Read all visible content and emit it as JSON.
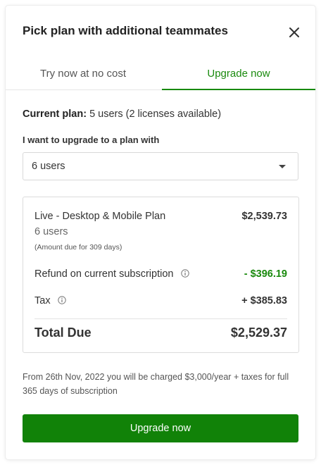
{
  "dialog": {
    "title": "Pick plan with additional teammates",
    "close_icon": "close-icon"
  },
  "tabs": [
    {
      "label": "Try now at no cost",
      "active": false
    },
    {
      "label": "Upgrade now",
      "active": true
    }
  ],
  "current_plan": {
    "label": "Current plan:",
    "value": "5 users (2 licenses available)"
  },
  "upgrade_select": {
    "label": "I want to upgrade to a plan with",
    "selected": "6 users",
    "icon": "chevron-down-icon"
  },
  "summary": {
    "plan_name": "Live - Desktop & Mobile Plan",
    "plan_price": "$2,539.73",
    "plan_users": "6 users",
    "plan_note": "(Amount due for 309 days)",
    "refund_label": "Refund on current subscription",
    "refund_value": "- $396.19",
    "tax_label": "Tax",
    "tax_value": "+ $385.83",
    "total_label": "Total Due",
    "total_value": "$2,529.37"
  },
  "footnote": "From 26th Nov, 2022 you will be charged $3,000/year + taxes for full 365 days of subscription",
  "primary_button": {
    "label": "Upgrade now"
  },
  "colors": {
    "accent_green": "#118208",
    "text_green": "#1a8a0e"
  }
}
